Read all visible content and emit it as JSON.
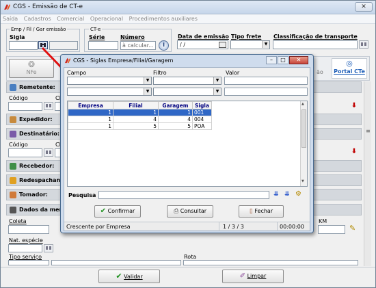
{
  "window": {
    "title": "CGS - Emissão de CT-e",
    "close_glyph": "✕"
  },
  "menu": [
    "Saída",
    "Cadastros",
    "Comercial",
    "Operacional",
    "Procedimentos auxiliares"
  ],
  "header": {
    "emp_group_label": "Emp / Fil / Gar emissão",
    "sigla_label": "Sigla",
    "cte_group_label": "CT-e",
    "serie_label": "Série",
    "numero_label": "Número",
    "numero_value": "à calcular...",
    "data_emissao_label": "Data de emissão",
    "data_emissao_value": "/ /",
    "tipo_frete_label": "Tipo frete",
    "classificacao_label": "Classificação de transporte",
    "nfe_label": "NFe",
    "portal_cte_label": "Portal CTe",
    "hidden_fragment": "ão"
  },
  "sections": {
    "remetente": "Remetente:",
    "codigo_label": "Código",
    "cl_label": "Cl",
    "expedidor": "Expedidor:",
    "destinatario": "Destinatário:",
    "codigo2_label": "Código",
    "cl2_label": "Cl",
    "recebedor": "Recebedor:",
    "redespachante": "Redespachante",
    "tomador": "Tomador:",
    "dados_mercadoria": "Dados da merca",
    "coleta_label": "Coleta",
    "km_label": "KM",
    "nat_especie_label": "Nat. espécie",
    "tipo_servico_label": "Tipo serviço",
    "rota_label": "Rota"
  },
  "footer": {
    "validar_label": "Validar",
    "limpar_label": "Limpar"
  },
  "dialog": {
    "title": "CGS - Siglas Empresa/Filial/Garagem",
    "campo_label": "Campo",
    "filtro_label": "Filtro",
    "valor_label": "Valor",
    "columns": [
      "Empresa",
      "Filial",
      "Garagem",
      "Sigla"
    ],
    "rows": [
      [
        "1",
        "1",
        "1",
        "001"
      ],
      [
        "1",
        "4",
        "4",
        "004"
      ],
      [
        "1",
        "5",
        "5",
        "POA"
      ]
    ],
    "pesquisa_label": "Pesquisa",
    "confirmar_label": "Confirmar",
    "consultar_label": "Consultar",
    "fechar_label": "Fechar",
    "status_order": "Crescente por Empresa",
    "status_count": "1 / 3 / 3",
    "status_time": "00:00:00"
  },
  "colors": {
    "accent_red": "#c00000",
    "selection_blue": "#2f67c6",
    "header_blue": "#000080"
  }
}
